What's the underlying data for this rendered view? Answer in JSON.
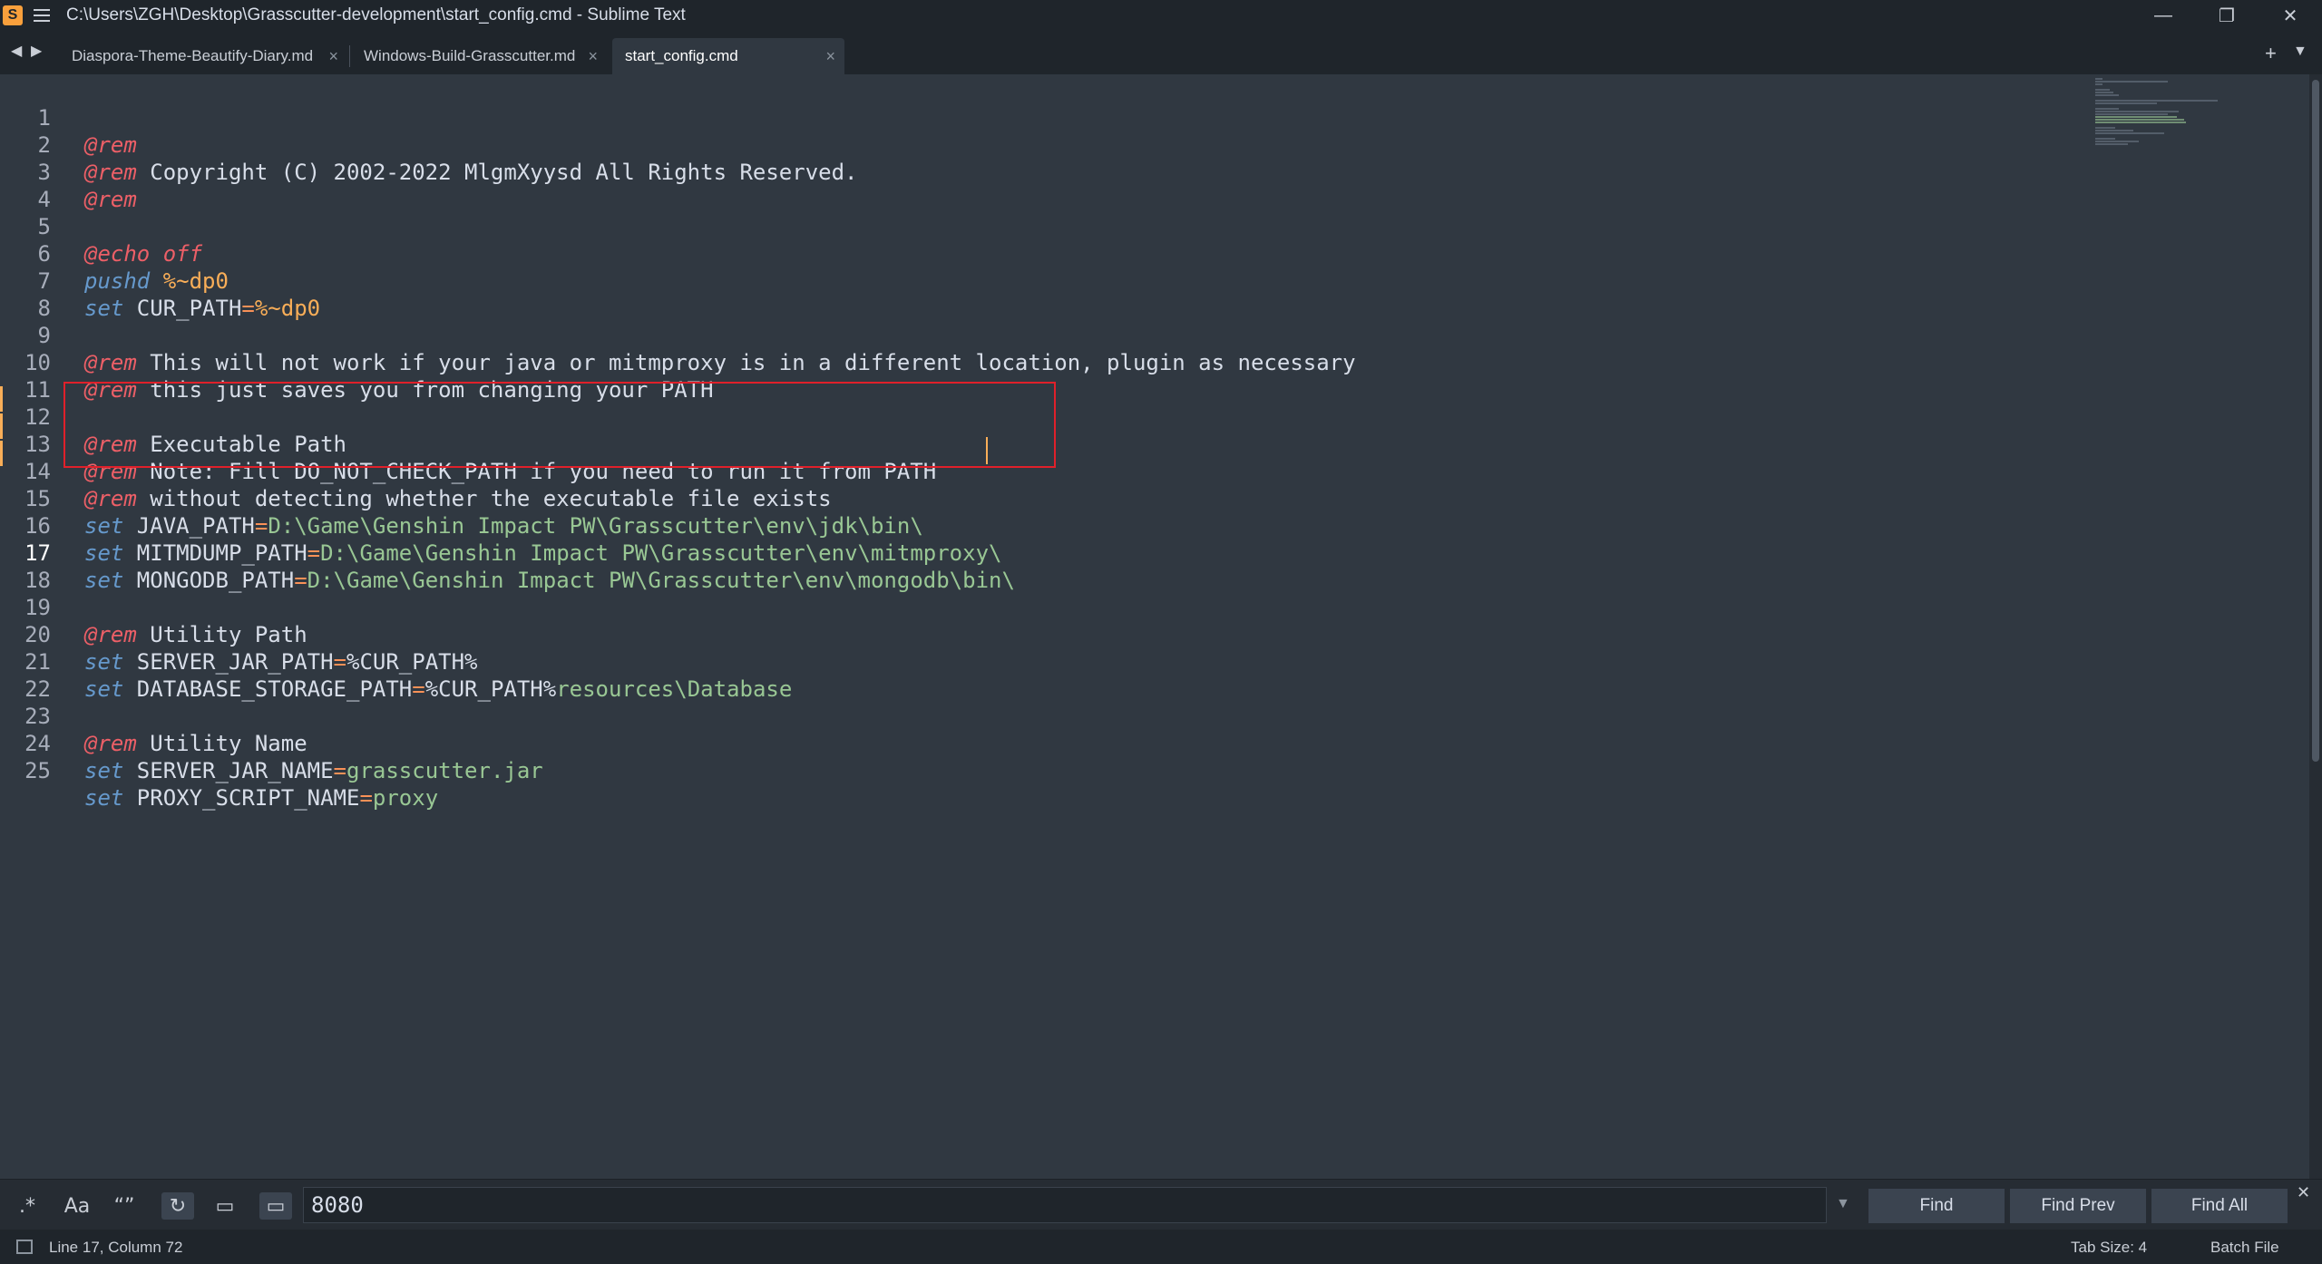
{
  "window": {
    "title": "C:\\Users\\ZGH\\Desktop\\Grasscutter-development\\start_config.cmd - Sublime Text",
    "minimize": "—",
    "maximize": "❐",
    "close": "✕"
  },
  "tabs": [
    {
      "label": "Diaspora-Theme-Beautify-Diary.md",
      "close": "×"
    },
    {
      "label": "Windows-Build-Grasscutter.md",
      "close": "×"
    },
    {
      "label": "start_config.cmd",
      "close": "×"
    }
  ],
  "nav": {
    "left": "◀",
    "right": "▶",
    "add": "+",
    "more": "▼"
  },
  "code_lines": [
    {
      "n": "1"
    },
    {
      "n": "2"
    },
    {
      "n": "3"
    },
    {
      "n": "4"
    },
    {
      "n": "5"
    },
    {
      "n": "6"
    },
    {
      "n": "7"
    },
    {
      "n": "8"
    },
    {
      "n": "9"
    },
    {
      "n": "10"
    },
    {
      "n": "11"
    },
    {
      "n": "12"
    },
    {
      "n": "13"
    },
    {
      "n": "14"
    },
    {
      "n": "15"
    },
    {
      "n": "16"
    },
    {
      "n": "17"
    },
    {
      "n": "18"
    },
    {
      "n": "19"
    },
    {
      "n": "20"
    },
    {
      "n": "21"
    },
    {
      "n": "22"
    },
    {
      "n": "23"
    },
    {
      "n": "24"
    },
    {
      "n": "25"
    }
  ],
  "tokens": {
    "rem": "@rem",
    "echo": "@echo",
    "off": "off",
    "pushd": "pushd",
    "set": "set",
    "eq": "=",
    "dp0": "%~dp0",
    "l2": " Copyright (C) 2002-2022 MlgmXyysd All Rights Reserved.",
    "l6": " ",
    "l7_var": " CUR_PATH",
    "l9": " This will not work if your java or mitmproxy is in a different location, plugin as necessary",
    "l10": " this just saves you from changing your PATH",
    "l12": " Executable Path",
    "l13": " Note: Fill DO_NOT_CHECK_PATH if you need to run it from PATH",
    "l14": " without detecting whether the executable file exists",
    "l15_var": " JAVA_PATH",
    "l15_val": "D:\\Game\\Genshin Impact PW\\Grasscutter\\env\\jdk\\bin\\",
    "l16_var": " MITMDUMP_PATH",
    "l16_val": "D:\\Game\\Genshin Impact PW\\Grasscutter\\env\\mitmproxy\\",
    "l17_var": " MONGODB_PATH",
    "l17_val": "D:\\Game\\Genshin Impact PW\\Grasscutter\\env\\mongodb\\bin\\",
    "l19": " Utility Path",
    "l20_var": " SERVER_JAR_PATH",
    "cur_path": "%CUR_PATH%",
    "l21_var": " DATABASE_STORAGE_PATH",
    "l21_val": "resources\\Database",
    "l23": " Utility Name",
    "l24_var": " SERVER_JAR_NAME",
    "l24_val": "grasscutter.jar",
    "l25_var": " PROXY_SCRIPT_NAME",
    "l25_val": "proxy"
  },
  "find": {
    "regex": ".*",
    "case": "Aa",
    "word": "“”",
    "wrap": "↻",
    "selection": "▭",
    "highlight": "▭",
    "value": "8080",
    "history": "▼",
    "find_label": "Find",
    "find_prev_label": "Find Prev",
    "find_all_label": "Find All",
    "close": "✕"
  },
  "status": {
    "position": "Line 17, Column 72",
    "tab_size": "Tab Size: 4",
    "syntax": "Batch File"
  },
  "colors": {
    "background": "#303841",
    "keyword": "#6699cc",
    "rem": "#ec5f67",
    "string": "#99c794",
    "highlight_box": "#e0202a"
  }
}
